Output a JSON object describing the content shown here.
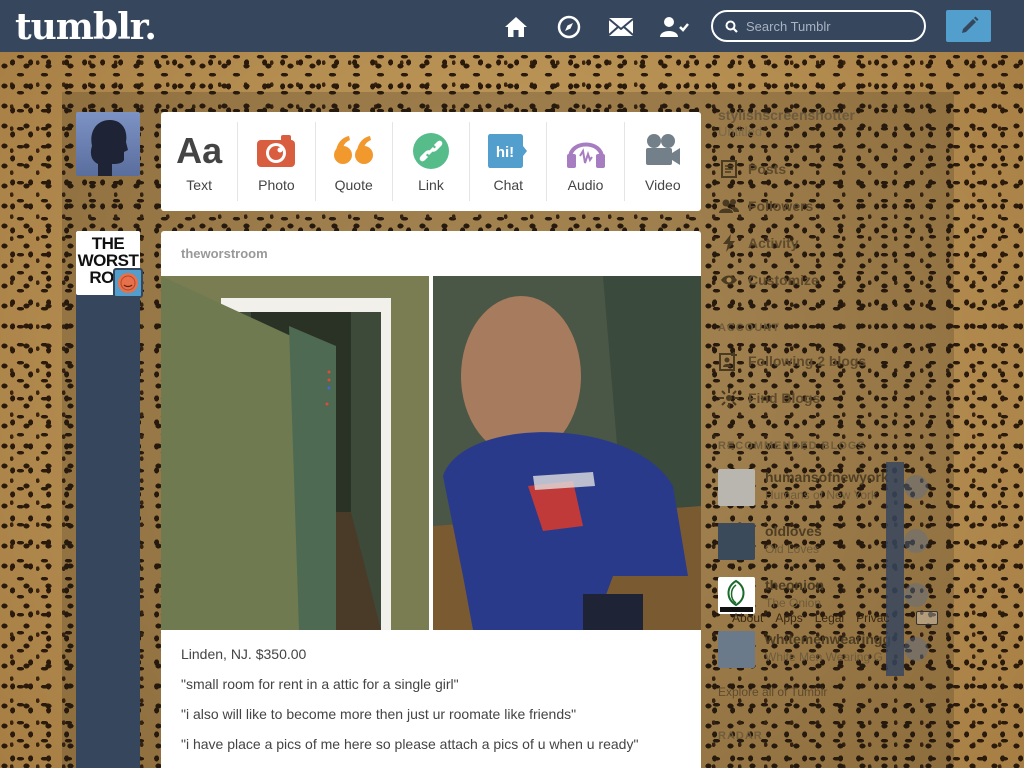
{
  "header": {
    "logo": "tumblr.",
    "search_placeholder": "Search Tumblr",
    "nav": [
      "home-icon",
      "explore-icon",
      "inbox-icon",
      "account-icon"
    ]
  },
  "post_types": [
    {
      "label": "Text",
      "glyph": "Aa",
      "color": "#444444"
    },
    {
      "label": "Photo",
      "glyph": "",
      "color": "#d95e40"
    },
    {
      "label": "Quote",
      "glyph": "“",
      "color": "#f2992e"
    },
    {
      "label": "Link",
      "glyph": "",
      "color": "#56bc8a"
    },
    {
      "label": "Chat",
      "glyph": "hi!",
      "color": "#529ecc"
    },
    {
      "label": "Audio",
      "glyph": "",
      "color": "#a77dc2"
    },
    {
      "label": "Video",
      "glyph": "",
      "color": "#748089"
    }
  ],
  "post": {
    "author": "theworstroom",
    "lines": [
      "Linden, NJ. $350.00",
      "\"small room for rent in a attic for a single girl\"",
      "\"i also will like to become more then just ur roomate like friends\"",
      "\"i have place a pics of me here so please attach a pics of u when u ready\""
    ]
  },
  "avatar_blog_text": "THE WORST ROO",
  "sidebar": {
    "blog_name": "stylishscreenshotter",
    "blog_sub": "Untitled",
    "items": [
      {
        "label": "Posts",
        "icon": "posts-icon"
      },
      {
        "label": "Followers",
        "icon": "followers-icon"
      },
      {
        "label": "Activity",
        "icon": "activity-icon"
      },
      {
        "label": "Customize",
        "icon": "eye-icon"
      }
    ],
    "account_heading": "ACCOUNT",
    "account_items": [
      {
        "label": "Following 2 blogs",
        "icon": "following-icon"
      },
      {
        "label": "Find Blogs",
        "icon": "find-blogs-icon"
      }
    ],
    "recommended_heading": "RECOMMENDED BLOGS",
    "recommended": [
      {
        "name": "humansofnewyork",
        "sub": "Humans of New York",
        "color": "#b8b6ae"
      },
      {
        "name": "oldloves",
        "sub": "Old Loves",
        "color": "#3a4a5a"
      },
      {
        "name": "theonion",
        "sub": "The Onion",
        "color": "#ffffff"
      },
      {
        "name": "whitemenwearingg",
        "sub": "White Men Wearing G",
        "color": "#6a7a8a"
      }
    ],
    "footer_links": [
      "About",
      "Apps",
      "Legal",
      "Privac"
    ],
    "explore": "Explore all of Tumblr",
    "radar_heading": "RADAR"
  }
}
